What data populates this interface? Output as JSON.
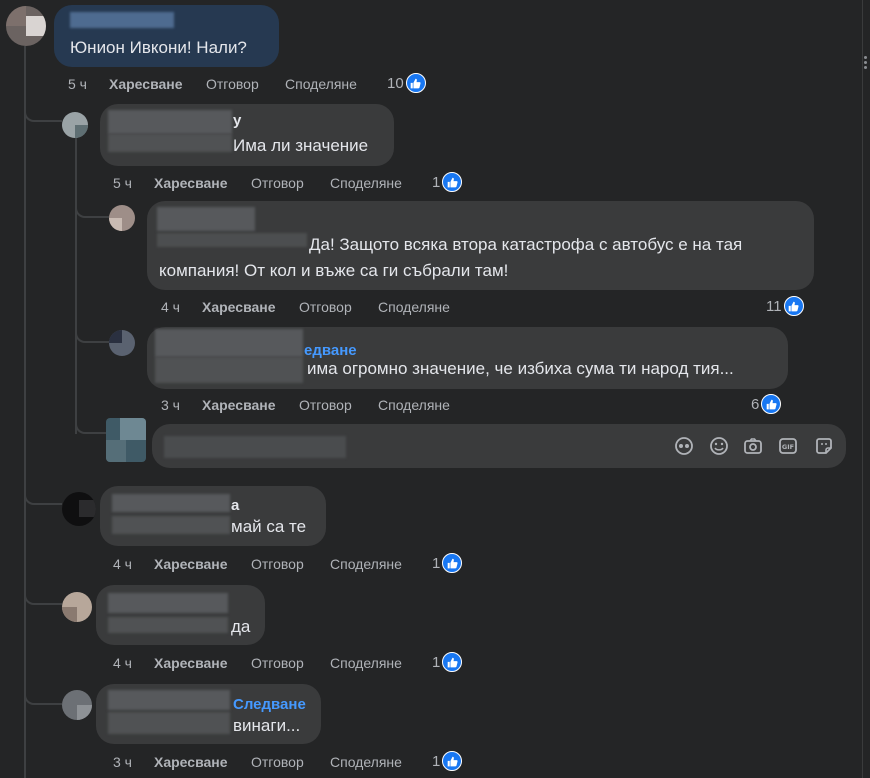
{
  "ui": {
    "colors": {
      "bg": "#242526",
      "bubble": "#3a3b3c",
      "bubble_active": "#263951",
      "text": "#e4e6eb",
      "muted": "#b0b3b8",
      "link": "#4599ff",
      "like": "#1877f2"
    }
  },
  "comments": [
    {
      "text": "Юнион Ивкони! Нали?",
      "time": "5 ч",
      "like": "Харесване",
      "reply": "Отговор",
      "share": "Споделяне",
      "reactions": "10"
    },
    {
      "suffix": "у",
      "text": "Има ли значение",
      "time": "5 ч",
      "like": "Харесване",
      "reply": "Отговор",
      "share": "Споделяне",
      "reactions": "1"
    },
    {
      "text_line1": "Да! Защото всяка втора катастрофа с автобус е на тая",
      "text_line2": "компания! От кол и въже са ги събрали там!",
      "time": "4 ч",
      "like": "Харесване",
      "reply": "Отговор",
      "share": "Споделяне",
      "reactions": "11"
    },
    {
      "follow": "едване",
      "text": "има огромно значение, че избиха сума ти народ тия...",
      "time": "3 ч",
      "like": "Харесване",
      "reply": "Отговор",
      "share": "Споделяне",
      "reactions": "6"
    },
    {
      "suffix": "а",
      "text": "май са те",
      "time": "4 ч",
      "like": "Харесване",
      "reply": "Отговор",
      "share": "Споделяне",
      "reactions": "1"
    },
    {
      "text": "да",
      "time": "4 ч",
      "like": "Харесване",
      "reply": "Отговор",
      "share": "Споделяне",
      "reactions": "1"
    },
    {
      "follow": "Следване",
      "text": "винаги...",
      "time": "3 ч",
      "like": "Харесване",
      "reply": "Отговор",
      "share": "Споделяне",
      "reactions": "1"
    }
  ],
  "reply_box": {
    "icons": [
      "avatar-sticker-icon",
      "emoji-icon",
      "camera-icon",
      "gif-icon",
      "sticker-icon"
    ]
  }
}
